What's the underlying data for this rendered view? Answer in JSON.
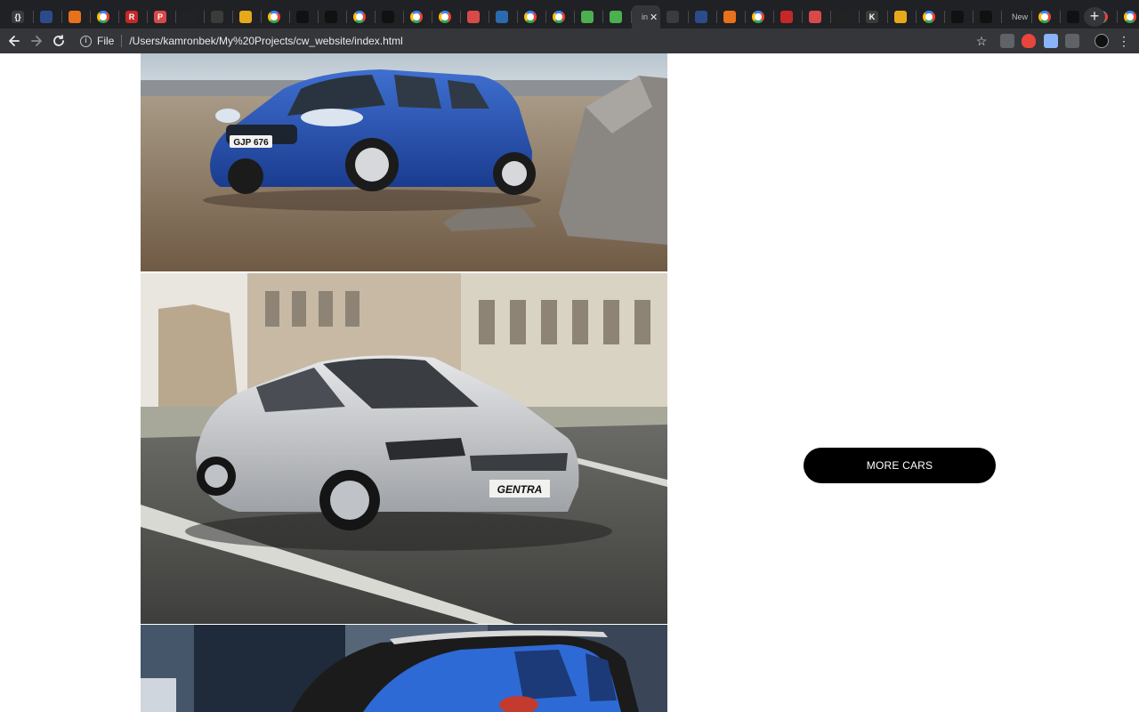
{
  "browser": {
    "active_tab_title": "in",
    "partial_tab_title": "New",
    "address": {
      "scheme_label": "File",
      "url": "/Users/kamronbek/My%20Projects/cw_website/index.html"
    },
    "icons": {
      "back": "back-arrow-icon",
      "forward": "forward-arrow-icon",
      "reload": "reload-icon",
      "info": "info-icon",
      "bookmark": "star-icon",
      "menu": "kebab-menu-icon",
      "new_tab": "plus-icon",
      "close_tab": "close-icon"
    },
    "tab_letters": [
      "{}",
      "",
      "",
      "",
      "R",
      "P",
      "",
      "",
      "",
      "",
      "",
      "",
      "",
      "",
      "",
      "",
      "",
      "",
      "",
      "",
      "",
      "",
      "",
      "",
      "",
      "",
      "",
      "",
      "",
      "K",
      "",
      "",
      "",
      "",
      "",
      "",
      "",
      "",
      ""
    ]
  },
  "page": {
    "gallery": {
      "images": [
        {
          "name": "blue-hatchback-car-photo",
          "plate": "GJP 676"
        },
        {
          "name": "silver-sedan-car-photo",
          "plate": "GENTRA"
        },
        {
          "name": "blue-suv-car-photo"
        }
      ]
    },
    "more_cars_button": {
      "label": "MORE CARS",
      "background": "#000000",
      "text_color": "#ffffff"
    }
  }
}
